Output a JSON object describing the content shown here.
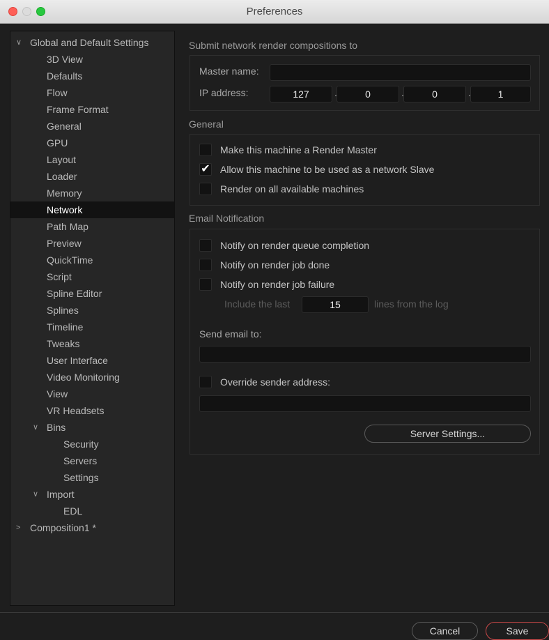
{
  "window": {
    "title": "Preferences"
  },
  "sidebar": {
    "items": [
      {
        "label": "Global and Default Settings",
        "chevron": "∨"
      },
      {
        "label": "3D View"
      },
      {
        "label": "Defaults"
      },
      {
        "label": "Flow"
      },
      {
        "label": "Frame Format"
      },
      {
        "label": "General"
      },
      {
        "label": "GPU"
      },
      {
        "label": "Layout"
      },
      {
        "label": "Loader"
      },
      {
        "label": "Memory"
      },
      {
        "label": "Network"
      },
      {
        "label": "Path Map"
      },
      {
        "label": "Preview"
      },
      {
        "label": "QuickTime"
      },
      {
        "label": "Script"
      },
      {
        "label": "Spline Editor"
      },
      {
        "label": "Splines"
      },
      {
        "label": "Timeline"
      },
      {
        "label": "Tweaks"
      },
      {
        "label": "User Interface"
      },
      {
        "label": "Video Monitoring"
      },
      {
        "label": "View"
      },
      {
        "label": "VR Headsets"
      },
      {
        "label": "Bins",
        "chevron": "∨"
      },
      {
        "label": "Security"
      },
      {
        "label": "Servers"
      },
      {
        "label": "Settings"
      },
      {
        "label": "Import",
        "chevron": "∨"
      },
      {
        "label": "EDL"
      },
      {
        "label": "Composition1 *",
        "chevron": ">"
      }
    ],
    "selected": "Network"
  },
  "network": {
    "section_title": "Submit network render compositions to",
    "master_name_label": "Master name:",
    "master_name_value": "",
    "ip_label": "IP address:",
    "ip": [
      "127",
      "0",
      "0",
      "1"
    ],
    "ip_sep": "."
  },
  "general": {
    "section_title": "General",
    "options": [
      {
        "label": "Make this machine a Render Master",
        "checked": false,
        "mark": ""
      },
      {
        "label": "Allow this machine to be used as a network Slave",
        "checked": true,
        "mark": "✔"
      },
      {
        "label": "Render on all available machines",
        "checked": false,
        "mark": ""
      }
    ]
  },
  "email": {
    "section_title": "Email Notification",
    "options": [
      {
        "label": "Notify on render queue completion",
        "checked": false
      },
      {
        "label": "Notify on render job done",
        "checked": false
      },
      {
        "label": "Notify on render job failure",
        "checked": false
      }
    ],
    "include_prefix": "Include the last",
    "include_value": "15",
    "include_suffix": "lines from the log",
    "send_to_label": "Send email to:",
    "send_to_value": "",
    "override_label": "Override sender address:",
    "override_value": "",
    "server_settings_button": "Server Settings..."
  },
  "footer": {
    "cancel_button": "Cancel",
    "save_button": "Save"
  },
  "colors": {
    "selection": "#121212",
    "save_border": "#c84848"
  }
}
